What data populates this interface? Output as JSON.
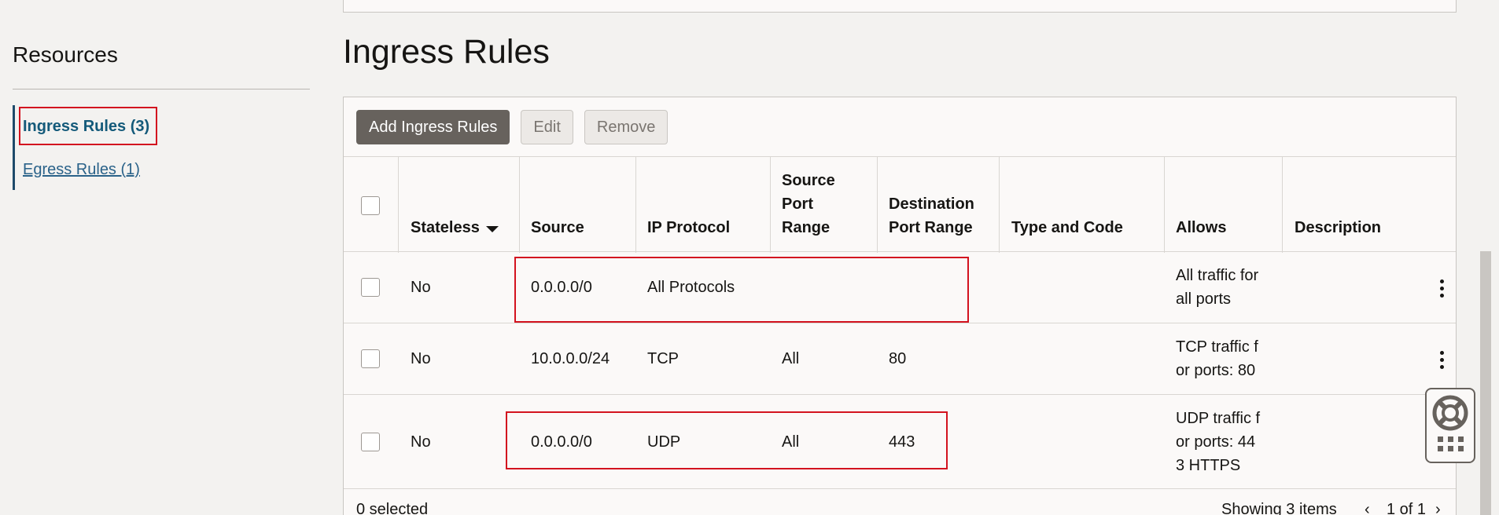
{
  "sidebar": {
    "title": "Resources",
    "items": [
      {
        "label": "Ingress Rules (3)"
      },
      {
        "label": "Egress Rules (1)"
      }
    ]
  },
  "page_title": "Ingress Rules",
  "toolbar": {
    "add_label": "Add Ingress Rules",
    "edit_label": "Edit",
    "remove_label": "Remove"
  },
  "table": {
    "headers": {
      "stateless": "Stateless",
      "source": "Source",
      "ip_protocol": "IP Protocol",
      "source_port_range": "Source Port Range",
      "destination_port_range": "Destination Port Range",
      "type_and_code": "Type and Code",
      "allows": "Allows",
      "description": "Description"
    },
    "rows": [
      {
        "stateless": "No",
        "source": "0.0.0.0/0",
        "ip_protocol": "All Protocols",
        "source_port_range": "",
        "destination_port_range": "",
        "type_and_code": "",
        "allows": "All traffic for all ports",
        "description": ""
      },
      {
        "stateless": "No",
        "source": "10.0.0.0/24",
        "ip_protocol": "TCP",
        "source_port_range": "All",
        "destination_port_range": "80",
        "type_and_code": "",
        "allows": "TCP traffic for ports: 80",
        "description": ""
      },
      {
        "stateless": "No",
        "source": "0.0.0.0/0",
        "ip_protocol": "UDP",
        "source_port_range": "All",
        "destination_port_range": "443",
        "type_and_code": "",
        "allows": "UDP traffic for ports: 443 HTTPS",
        "description": ""
      }
    ]
  },
  "footer": {
    "selected_label": "0 selected",
    "showing_label": "Showing 3 items",
    "page_label": "1 of 1"
  },
  "colors": {
    "accent": "#23618c",
    "highlight": "#d3131f",
    "primary_button": "#67625d"
  }
}
